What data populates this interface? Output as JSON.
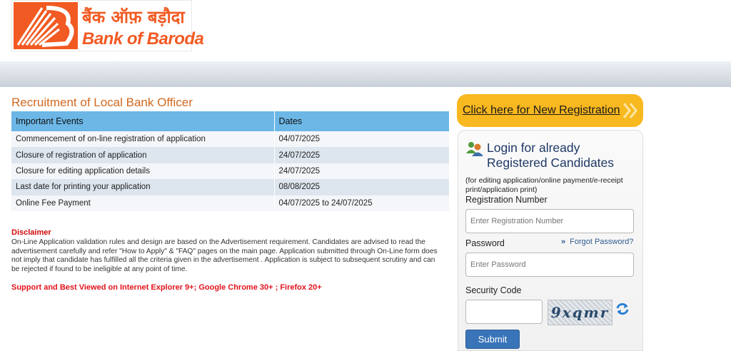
{
  "logo": {
    "hindi": "बैंक ऑफ़ बड़ौदा",
    "english": "Bank of Baroda"
  },
  "colors": {
    "brand_orange": "#f15a22",
    "title_orange": "#d2691e",
    "table_header": "#6cb7e6",
    "register_yellow": "#f8b81f",
    "disclaimer_red": "#d10a0a",
    "submit_blue": "#3a74b8"
  },
  "page_title": "Recruitment of Local Bank Officer",
  "events_table": {
    "headers": [
      "Important Events",
      "Dates"
    ],
    "rows": [
      [
        "Commencement of on-line registration of application",
        "04/07/2025"
      ],
      [
        "Closure of registration of application",
        "24/07/2025"
      ],
      [
        "Closure for editing application details",
        "24/07/2025"
      ],
      [
        "Last date for printing your application",
        "08/08/2025"
      ],
      [
        "Online Fee Payment",
        "04/07/2025 to 24/07/2025"
      ]
    ]
  },
  "disclaimer": {
    "title": "Disclaimer",
    "text": "On-Line Application validation rules and design are based on the Advertisement requirement. Candidates are advised to read the advertisement carefully and refer \"How to Apply\" & \"FAQ\" pages on the main page. Application submitted through On-Line form does not imply that candidate has fulfilled all the criteria given in the advertisement . Application is subject to subsequent scrutiny and can be rejected if found to be ineligible at any point of time."
  },
  "support_note": "Support and Best Viewed on Internet Explorer 9+; Google Chrome 30+ ; Firefox 20+",
  "new_registration": {
    "label": "Click here for New Registration",
    "icon": "double-chevron-right-icon"
  },
  "login": {
    "icon": "users-icon",
    "title": "Login for already Registered Candidates",
    "note": "(for editing application/online payment/e-receipt print/application print)",
    "registration_label": "Registration Number",
    "registration_placeholder": "Enter Registration Number",
    "password_label": "Password",
    "password_placeholder": "Enter Password",
    "forgot_password": "Forgot Password?",
    "security_code_label": "Security Code",
    "captcha_text": "9xqmr",
    "refresh_icon": "refresh-icon",
    "submit_label": "Submit"
  }
}
